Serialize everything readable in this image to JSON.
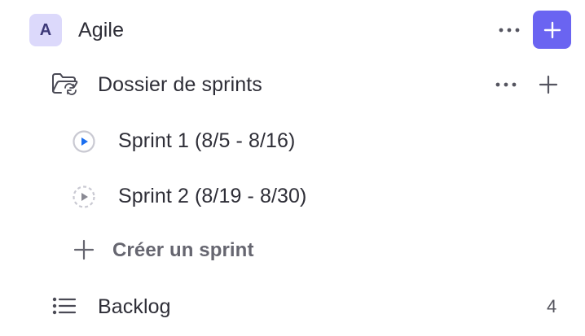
{
  "space": {
    "avatar_letter": "A",
    "name": "Agile",
    "accent_color": "#6a64f1"
  },
  "folder": {
    "name": "Dossier de sprints"
  },
  "sprints": [
    {
      "label": "Sprint 1 (8/5 - 8/16)",
      "status": "active",
      "icon": "sprint-active-icon"
    },
    {
      "label": "Sprint 2 (8/19 - 8/30)",
      "status": "upcoming",
      "icon": "sprint-upcoming-icon"
    }
  ],
  "create_sprint": {
    "label": "Créer un sprint"
  },
  "backlog": {
    "label": "Backlog",
    "count": "4"
  }
}
